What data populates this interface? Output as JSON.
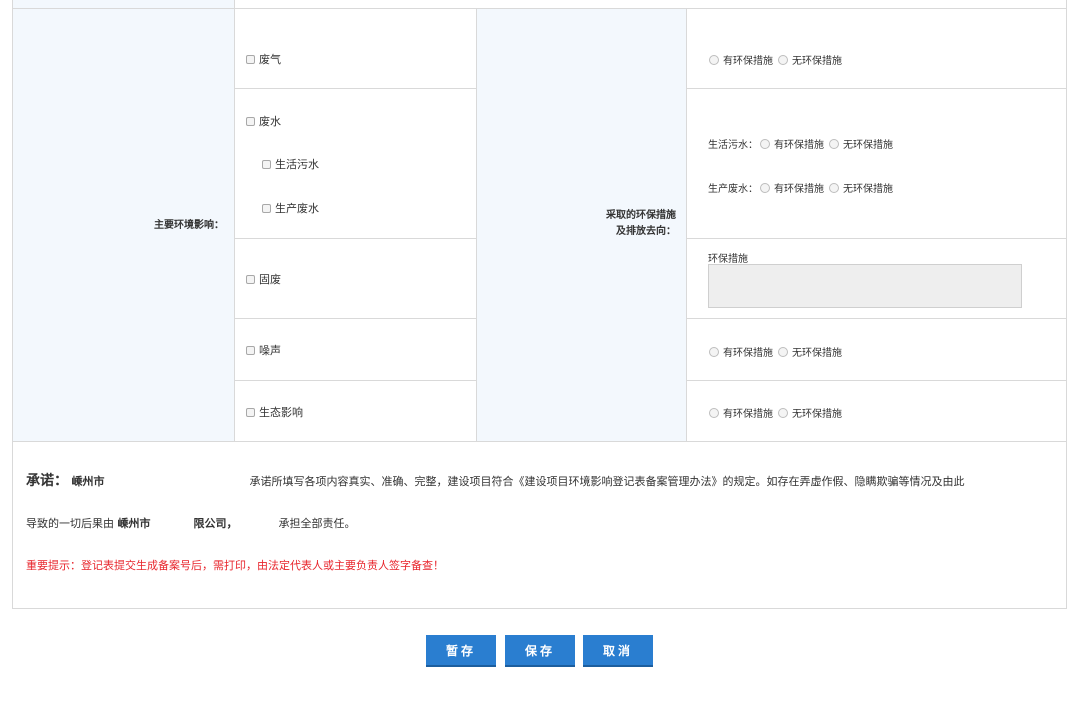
{
  "left_label": "主要环境影响：",
  "right_label_line1": "采取的环保措施",
  "right_label_line2": "及排放去向：",
  "impacts": {
    "waste_gas": "废气",
    "waste_water": "废水",
    "domestic_sewage": "生活污水",
    "production_wastewater": "生产废水",
    "solid_waste": "固废",
    "noise": "噪声",
    "ecology": "生态影响"
  },
  "measures": {
    "has": "有环保措施",
    "none": "无环保措施",
    "domestic_label": "生活污水：",
    "production_label": "生产废水：",
    "env_measures_label": "环保措施",
    "env_measures_value": ""
  },
  "promise": {
    "title": "承诺：",
    "company_start": "嵊州市",
    "text1": "承诺所填写各项内容真实、准确、完整，建设项目符合《建设项目环境影响登记表备案管理办法》的规定。如存在弄虚作假、隐瞒欺骗等情况及由此",
    "text2_a": "导致的一切后果由",
    "company2_a": "嵊州市",
    "company2_b": "限公司，",
    "text2_b": "承担全部责任。",
    "warning": "重要提示：登记表提交生成备案号后，需打印，由法定代表人或主要负责人签字备查！"
  },
  "buttons": {
    "temp_save": "暂存",
    "save": "保存",
    "cancel": "取消"
  }
}
